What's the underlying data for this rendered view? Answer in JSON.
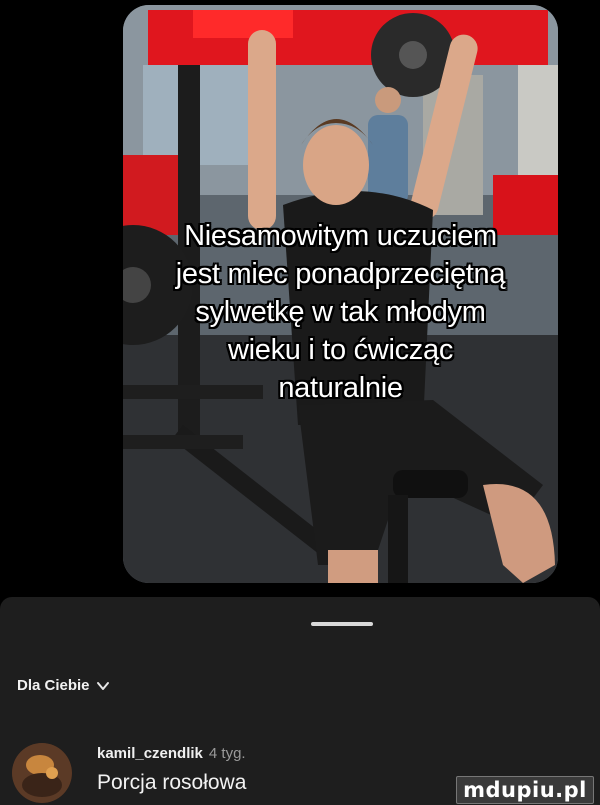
{
  "video": {
    "caption_lines": [
      "Niesamowitym uczuciem",
      "jest miec ponadprzeciętną",
      "sylwetkę w tak młodym",
      "wieku i to ćwicząc",
      "naturalnie"
    ]
  },
  "comments_sheet": {
    "section_title": "Dla Ciebie",
    "chevron_icon": "chevron-down-icon",
    "comment": {
      "username": "kamil_czendlik",
      "time": "4 tyg.",
      "text": "Porcja rosołowa"
    }
  },
  "watermark": "mdupiu.pl",
  "colors": {
    "background": "#000000",
    "sheet": "#1e1e1e",
    "gym_red": "#e0161e"
  }
}
